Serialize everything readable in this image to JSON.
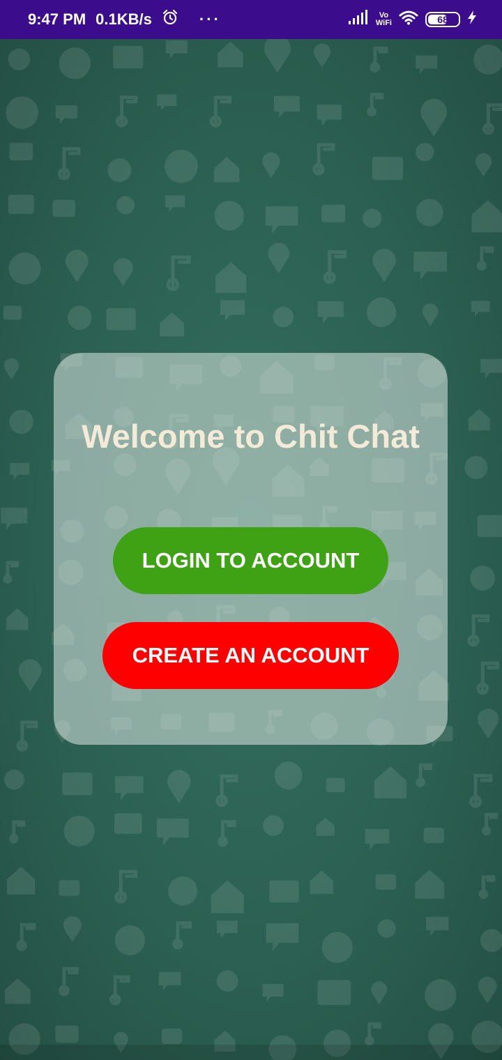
{
  "status_bar": {
    "time": "9:47 PM",
    "network_speed": "0.1KB/s",
    "alarm_icon": "alarm-icon",
    "more_dots": "···",
    "signal_icon": "signal-icon",
    "volte_line1": "Vo",
    "volte_line2": "WiFi",
    "wifi_icon": "wifi-icon",
    "battery_level": "68",
    "battery_fraction": 0.68,
    "charging_icon": "charging-bolt-icon"
  },
  "colors": {
    "status_bar": "#3b0d8c",
    "background": "#2a5d4f",
    "login_button": "#3fa214",
    "create_button": "#fe0000",
    "title_text": "#f4ead8"
  },
  "welcome": {
    "title": "Welcome to Chit Chat",
    "login_label": "LOGIN TO ACCOUNT",
    "create_label": "CREATE AN ACCOUNT"
  }
}
